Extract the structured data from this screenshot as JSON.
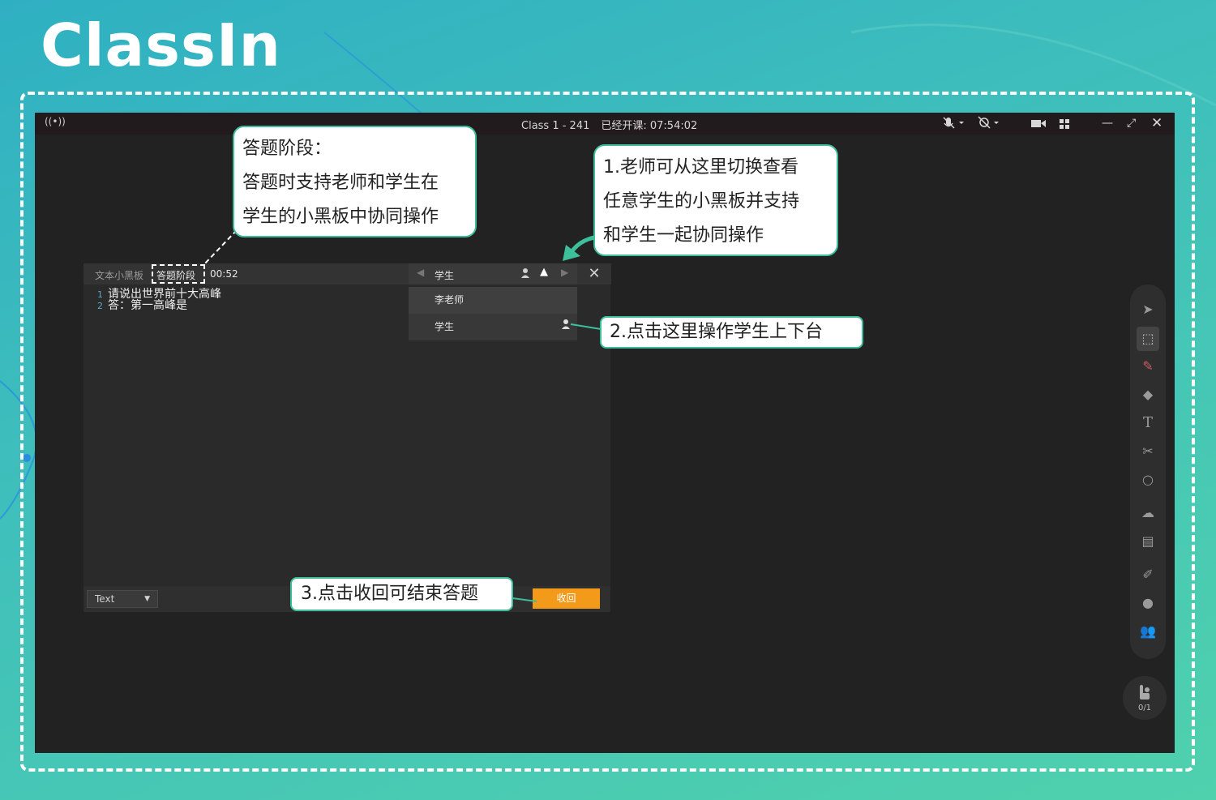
{
  "logo": {
    "text": "ClassIn"
  },
  "window": {
    "title": "Class 1 - 241",
    "class_timer": "已经开课: 07:54:02",
    "icons": [
      "broadcast-icon",
      "mic-muted-icon",
      "camera-muted-icon",
      "video-icon",
      "grid-icon",
      "minimize-icon",
      "expand-icon",
      "close-icon"
    ]
  },
  "board": {
    "title": "文本小黑板",
    "phase": "答题阶段",
    "timer": "00:52",
    "lines": [
      {
        "num": "1",
        "text": "请说出世界前十大高峰"
      },
      {
        "num": "2",
        "text": "答：第一高峰是"
      }
    ],
    "text_mode": "Text",
    "recall_label": "收回"
  },
  "student_panel": {
    "header_label": "学生",
    "items": [
      {
        "label": "李老师"
      },
      {
        "label": "学生"
      }
    ]
  },
  "hand_raise": {
    "count": "0/1"
  },
  "callouts": {
    "phase": [
      "答题阶段：",
      "答题时支持老师和学生在",
      "学生的小黑板中协同操作"
    ],
    "switch": [
      "1.老师可从这里切换查看",
      "任意学生的小黑板并支持",
      "和学生一起协同操作"
    ],
    "stage": "2.点击这里操作学生上下台",
    "recall": "3.点击收回可结束答题"
  },
  "colors": {
    "accent": "#3cbf9a",
    "recall_button": "#f39a1a",
    "window_bg": "#222222",
    "titlebar_bg": "#221b1d"
  }
}
